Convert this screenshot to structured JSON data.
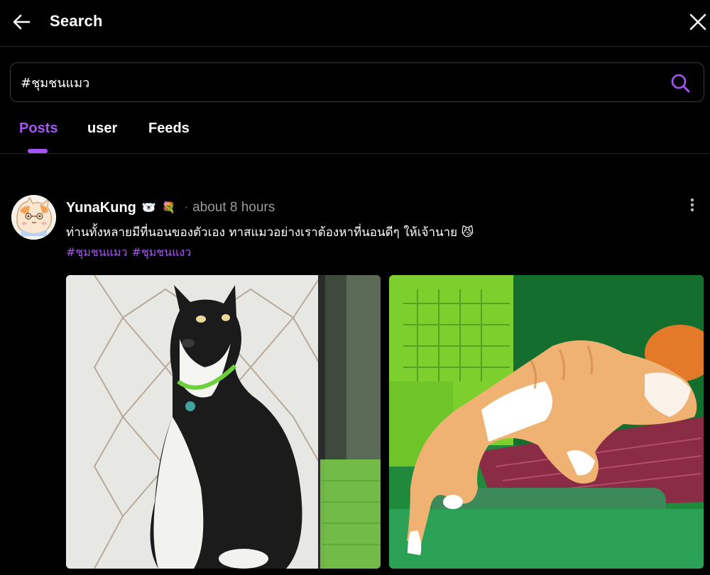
{
  "header": {
    "title": "Search"
  },
  "search": {
    "value": "#ชุมชนแมว",
    "placeholder": ""
  },
  "tabs": [
    {
      "label": "Posts",
      "active": true
    },
    {
      "label": "user",
      "active": false
    },
    {
      "label": "Feeds",
      "active": false
    }
  ],
  "post": {
    "username": "YunaKung",
    "badges": [
      "🐻‍❄️",
      "💐"
    ],
    "separator": "·",
    "timestamp": "about 8 hours",
    "text": "ท่านทั้งหลายมีที่นอนของตัวเอง ทาสแมวอย่างเราต้องหาที่นอนดีๆ ให้เจ้านาย 😼",
    "hashtags": [
      "#ชุมชนแมว",
      "#ชุมชนแงว"
    ],
    "photos": [
      "cat-sitting-by-window",
      "cat-lying-on-cushion"
    ]
  },
  "colors": {
    "accent": "#a855f7",
    "background": "#000000",
    "muted": "#9a9a9a",
    "border": "#2a2a2a"
  },
  "icons": {
    "back": "arrow-left-icon",
    "close": "close-icon",
    "search": "search-icon",
    "more": "more-vertical-icon"
  }
}
